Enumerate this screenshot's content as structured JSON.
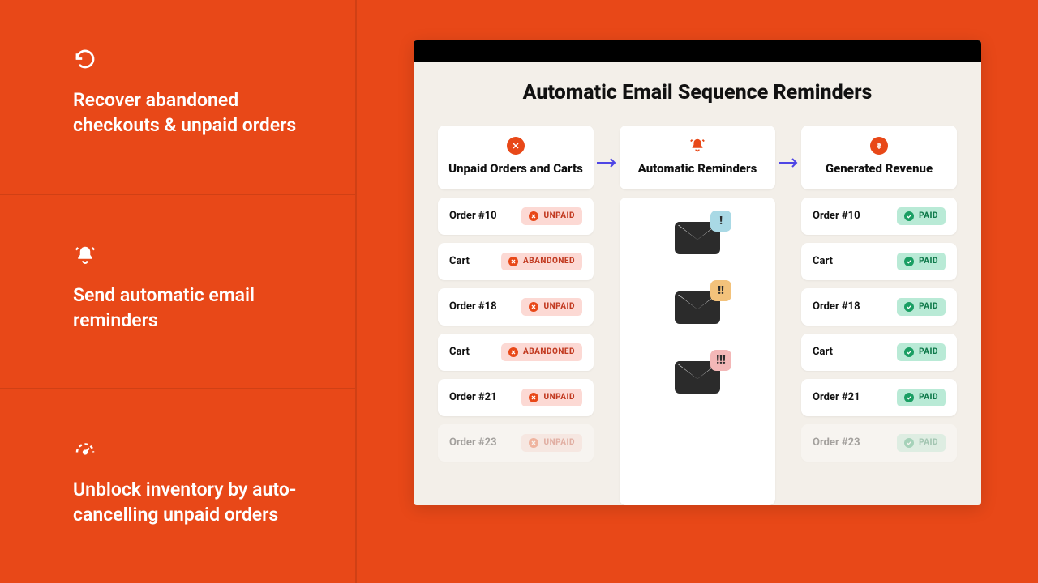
{
  "sidebar": {
    "features": [
      {
        "label": "Recover abandoned checkouts & unpaid orders"
      },
      {
        "label": "Send automatic email reminders"
      },
      {
        "label": "Unblock inventory by auto-cancelling unpaid orders"
      }
    ]
  },
  "panel": {
    "title": "Automatic Email Sequence Reminders",
    "columns": {
      "left": {
        "title": "Unpaid Orders and Carts",
        "rows": [
          {
            "name": "Order #10",
            "status": "UNPAID"
          },
          {
            "name": "Cart",
            "status": "ABANDONED"
          },
          {
            "name": "Order #18",
            "status": "UNPAID"
          },
          {
            "name": "Cart",
            "status": "ABANDONED"
          },
          {
            "name": "Order #21",
            "status": "UNPAID"
          },
          {
            "name": "Order #23",
            "status": "UNPAID"
          }
        ]
      },
      "middle": {
        "title": "Automatic Reminders",
        "bubbles": [
          "!",
          "!!",
          "!!!"
        ]
      },
      "right": {
        "title": "Generated Revenue",
        "rows": [
          {
            "name": "Order #10",
            "status": "PAID"
          },
          {
            "name": "Cart",
            "status": "PAID"
          },
          {
            "name": "Order #18",
            "status": "PAID"
          },
          {
            "name": "Cart",
            "status": "PAID"
          },
          {
            "name": "Order #21",
            "status": "PAID"
          },
          {
            "name": "Order #23",
            "status": "PAID"
          }
        ]
      }
    }
  }
}
